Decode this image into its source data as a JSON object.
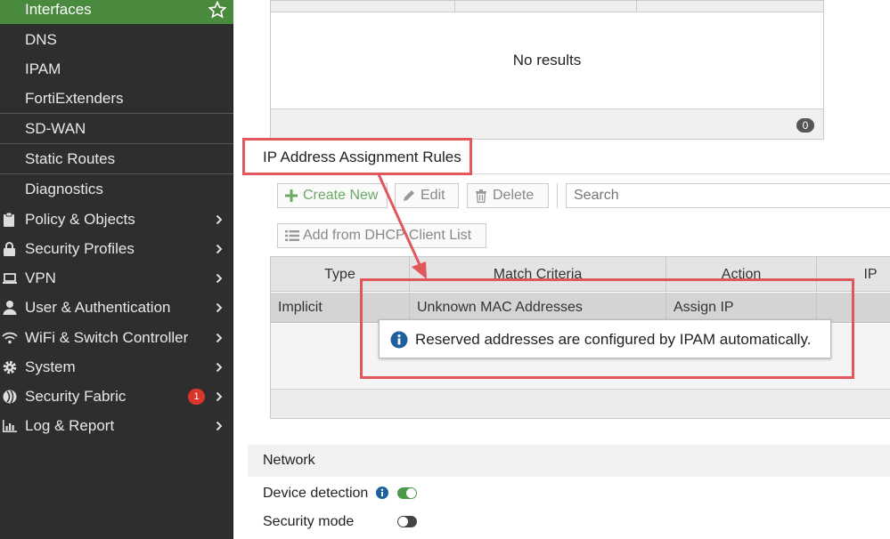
{
  "sidebar": {
    "sub_items": [
      {
        "label": "Interfaces"
      },
      {
        "label": "DNS"
      },
      {
        "label": "IPAM"
      },
      {
        "label": "FortiExtenders"
      },
      {
        "label": "SD-WAN"
      },
      {
        "label": "Static Routes"
      },
      {
        "label": "Diagnostics"
      }
    ],
    "main_items": [
      {
        "label": "Policy & Objects",
        "icon": "clipboard-icon"
      },
      {
        "label": "Security Profiles",
        "icon": "lock-icon"
      },
      {
        "label": "VPN",
        "icon": "laptop-icon"
      },
      {
        "label": "User & Authentication",
        "icon": "user-icon"
      },
      {
        "label": "WiFi & Switch Controller",
        "icon": "wifi-icon"
      },
      {
        "label": "System",
        "icon": "gear-icon"
      },
      {
        "label": "Security Fabric",
        "icon": "fabric-icon",
        "badge": "1"
      },
      {
        "label": "Log & Report",
        "icon": "bar-chart-icon"
      }
    ]
  },
  "top_table": {
    "empty_text": "No results",
    "count": "0"
  },
  "rules": {
    "title": "IP Address Assignment Rules",
    "toolbar": {
      "create_label": "Create New",
      "edit_label": "Edit",
      "delete_label": "Delete",
      "search_placeholder": "Search",
      "dhcp_label": "Add from DHCP Client List"
    },
    "columns": [
      "Type",
      "Match Criteria",
      "Action",
      "IP"
    ],
    "rows": [
      {
        "type": "Implicit",
        "match": "Unknown MAC Addresses",
        "action": "Assign IP",
        "ip": ""
      }
    ],
    "tooltip": "Reserved addresses are configured by IPAM automatically."
  },
  "network": {
    "title": "Network",
    "device_detection_label": "Device detection",
    "security_mode_label": "Security mode"
  },
  "colors": {
    "active_green": "#4a8a3e",
    "highlight_red": "#e0585b",
    "badge_red": "#d9352b"
  }
}
